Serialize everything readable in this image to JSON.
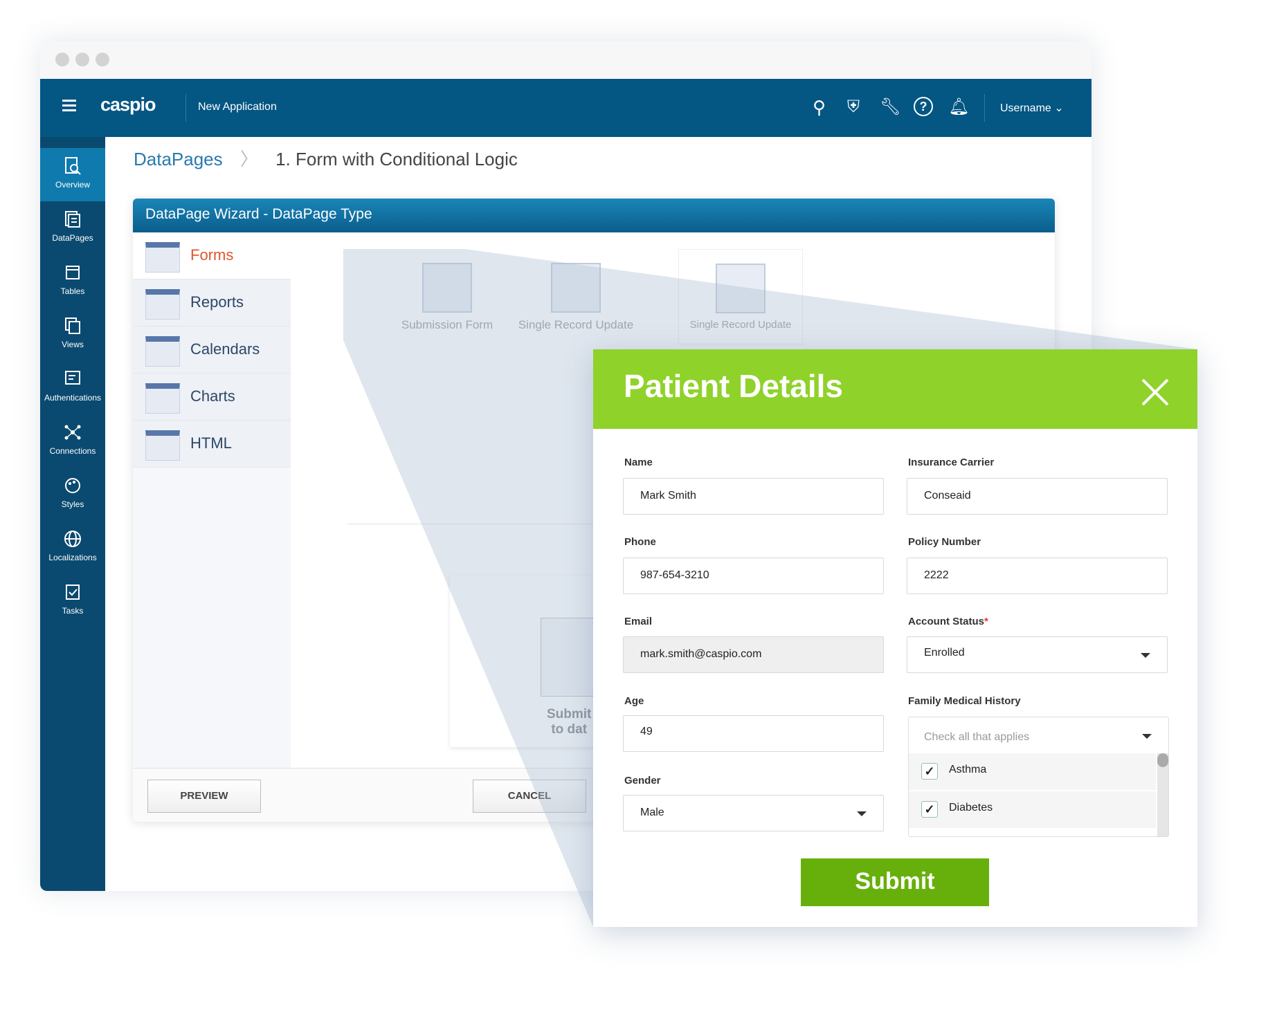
{
  "header": {
    "app_name": "caspio",
    "app_title": "New Application",
    "username": "Username"
  },
  "sidebar": {
    "items": [
      {
        "label": "Overview",
        "icon": "overview-icon",
        "active": true
      },
      {
        "label": "DataPages",
        "icon": "datapages-icon"
      },
      {
        "label": "Tables",
        "icon": "tables-icon"
      },
      {
        "label": "Views",
        "icon": "views-icon"
      },
      {
        "label": "Authentications",
        "icon": "authentications-icon"
      },
      {
        "label": "Connections",
        "icon": "connections-icon"
      },
      {
        "label": "Styles",
        "icon": "styles-icon"
      },
      {
        "label": "Localizations",
        "icon": "globe-icon"
      },
      {
        "label": "Tasks",
        "icon": "tasks-icon"
      }
    ]
  },
  "breadcrumb": {
    "root": "DataPages",
    "current": "1. Form with Conditional Logic"
  },
  "wizard": {
    "title": "DataPage Wizard - DataPage Type",
    "types": [
      "Forms",
      "Reports",
      "Calendars",
      "Charts",
      "HTML"
    ],
    "cards": [
      "Submission Form",
      "Single Record Update",
      "Single Record Update"
    ],
    "preview_text": [
      "Submit",
      "to dat"
    ],
    "preview_label": "PREVIEW",
    "cancel_label": "CANCEL"
  },
  "modal": {
    "title": "Patient Details",
    "fields": {
      "name": {
        "label": "Name",
        "value": "Mark Smith"
      },
      "insurance": {
        "label": "Insurance Carrier",
        "value": "Conseaid"
      },
      "phone": {
        "label": "Phone",
        "value": "987-654-3210"
      },
      "policy": {
        "label": "Policy Number",
        "value": "2222"
      },
      "email": {
        "label": "Email",
        "value": "mark.smith@caspio.com"
      },
      "status": {
        "label": "Account Status",
        "required": "*",
        "value": "Enrolled"
      },
      "age": {
        "label": "Age",
        "value": "49"
      },
      "history": {
        "label": "Family Medical History",
        "placeholder": "Check all that applies",
        "options": [
          {
            "label": "Asthma",
            "checked": true
          },
          {
            "label": "Diabetes",
            "checked": true
          }
        ]
      },
      "gender": {
        "label": "Gender",
        "value": "Male"
      }
    },
    "submit_label": "Submit"
  },
  "colors": {
    "header": "#045683",
    "sidebar": "#0a4a70",
    "modal_header": "#8fd22a",
    "submit": "#67b00b",
    "forms_active": "#e0562a"
  }
}
